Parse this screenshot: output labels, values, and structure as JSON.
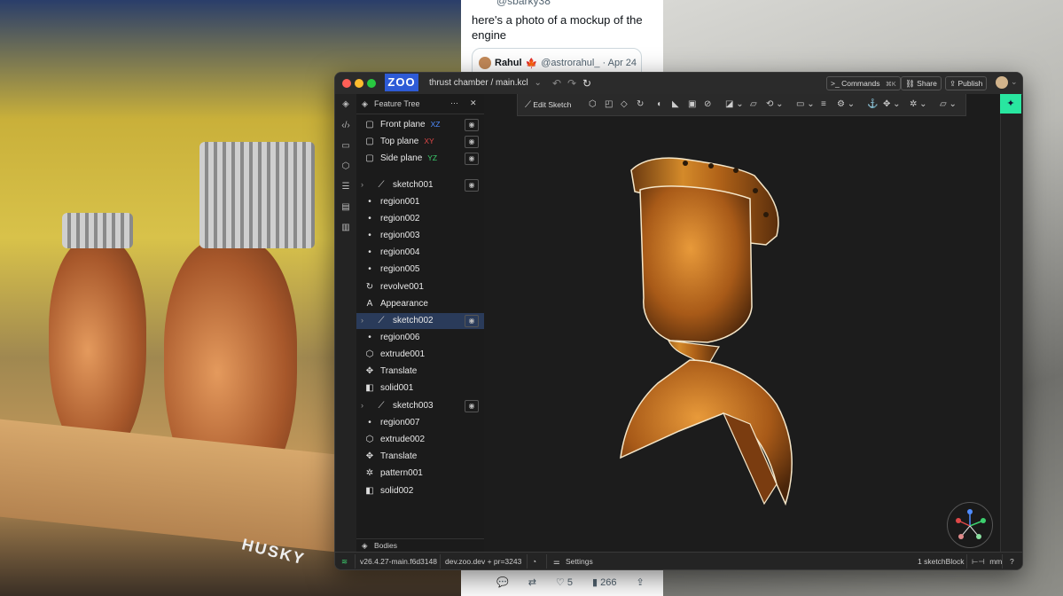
{
  "background": {
    "tweet": {
      "handle": "@sbarky38",
      "text": "here's a photo of a mockup of the engine",
      "quote_name": "Rahul",
      "quote_flag": "🍁",
      "quote_handle": "@astrorahul_ · Apr 24",
      "likes": "5",
      "views": "266"
    },
    "photo_brand": "HUSKY"
  },
  "app": {
    "logo": "ZOO",
    "file_path": "thrust chamber / main.kcl",
    "commands_label": "Commands",
    "commands_shortcut": "⌘K",
    "share_label": "Share",
    "publish_label": "Publish",
    "feature_tree_title": "Feature Tree",
    "bodies_label": "Bodies",
    "edit_sketch_label": "Edit Sketch",
    "tree": [
      {
        "label": "Front plane",
        "axis": "XZ",
        "axis_color": "#4f8cff",
        "icon": "plane-icon",
        "glyph": "▢",
        "eye": true
      },
      {
        "label": "Top plane",
        "axis": "XY",
        "axis_color": "#e04848",
        "icon": "plane-icon",
        "glyph": "▢",
        "eye": true
      },
      {
        "label": "Side plane",
        "axis": "YZ",
        "axis_color": "#3ccf6e",
        "icon": "plane-icon",
        "glyph": "▢",
        "eye": true
      },
      {
        "label": "sketch001",
        "icon": "sketch-icon",
        "glyph": "⟋",
        "chevron": true,
        "eye": true
      },
      {
        "label": "region001",
        "icon": "dot-icon",
        "glyph": "•"
      },
      {
        "label": "region002",
        "icon": "dot-icon",
        "glyph": "•"
      },
      {
        "label": "region003",
        "icon": "dot-icon",
        "glyph": "•"
      },
      {
        "label": "region004",
        "icon": "dot-icon",
        "glyph": "•"
      },
      {
        "label": "region005",
        "icon": "dot-icon",
        "glyph": "•"
      },
      {
        "label": "revolve001",
        "icon": "revolve-icon",
        "glyph": "↻"
      },
      {
        "label": "Appearance",
        "icon": "appearance-icon",
        "glyph": "A"
      },
      {
        "label": "sketch002",
        "icon": "sketch-icon",
        "glyph": "⟋",
        "chevron": true,
        "eye": true,
        "selected": true
      },
      {
        "label": "region006",
        "icon": "dot-icon",
        "glyph": "•"
      },
      {
        "label": "extrude001",
        "icon": "extrude-icon",
        "glyph": "⬡"
      },
      {
        "label": "Translate",
        "icon": "translate-icon",
        "glyph": "✥"
      },
      {
        "label": "solid001",
        "icon": "solid-icon",
        "glyph": "◧"
      },
      {
        "label": "sketch003",
        "icon": "sketch-icon",
        "glyph": "⟋",
        "chevron": true,
        "eye": true
      },
      {
        "label": "region007",
        "icon": "dot-icon",
        "glyph": "•"
      },
      {
        "label": "extrude002",
        "icon": "extrude-icon",
        "glyph": "⬡"
      },
      {
        "label": "Translate",
        "icon": "translate-icon",
        "glyph": "✥"
      },
      {
        "label": "pattern001",
        "icon": "pattern-icon",
        "glyph": "✲"
      },
      {
        "label": "solid002",
        "icon": "solid-icon",
        "glyph": "◧"
      }
    ],
    "status": {
      "version": "v26.4.27-main.f6d3148",
      "env": "dev.zoo.dev + pr=3243",
      "settings_label": "Settings",
      "sketch_blocks": "1 sketchBlock",
      "units": "mm",
      "help": "?"
    },
    "colors": {
      "accent": "#2e5bd6",
      "copper": "#c8741e",
      "assistant": "#29e6a0"
    }
  }
}
